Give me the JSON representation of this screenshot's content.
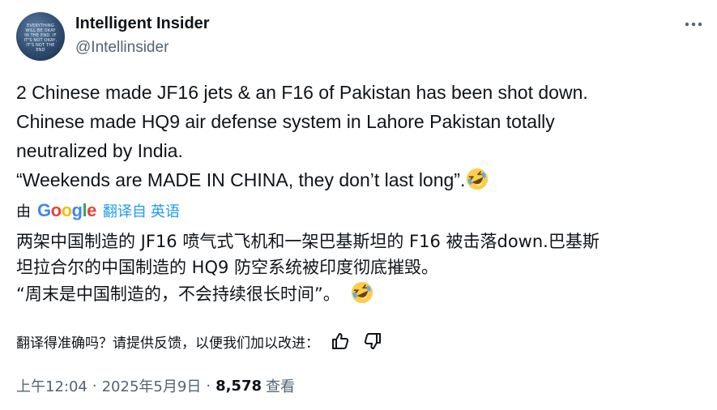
{
  "author": {
    "avatar_text": "EVERYTHING WILL BE OKAY IN THE END. IF IT'S NOT OKAY, IT'S NOT THE END",
    "display_name": "Intelligent Insider",
    "handle": "@Intellinsider",
    "avatar_color": "#2f4b6e"
  },
  "more_icon": "ellipsis-icon",
  "tweet": {
    "lines": [
      "2 Chinese made JF16 jets & an F16 of Pakistan has been shot down.",
      "Chinese made HQ9 air defense system in Lahore Pakistan totally",
      "neutralized by India.",
      "“Weekends are MADE IN CHINA, they don’t last long”."
    ],
    "emoji": "rolling-on-floor-laughing"
  },
  "translation_bar": {
    "by_label": "由",
    "google_letters": [
      "G",
      "o",
      "o",
      "g",
      "l",
      "e"
    ],
    "google_colors": [
      "#4285F4",
      "#EA4335",
      "#FBBC05",
      "#4285F4",
      "#34A853",
      "#EA4335"
    ],
    "translated_from": "翻译自 英语",
    "link_color": "#1d9bf0"
  },
  "translation": {
    "lines": [
      "两架中国制造的 JF16 喷气式飞机和一架巴基斯坦的 F16 被击落down.巴基斯",
      "坦拉合尔的中国制造的 HQ9 防空系统被印度彻底摧毁。",
      "“周末是中国制造的，不会持续很长时间”。 "
    ]
  },
  "feedback": {
    "prompt": "翻译得准确吗？请提供反馈，以便我们加以改进：",
    "thumbs_up_icon": "thumbs-up-icon",
    "thumbs_down_icon": "thumbs-down-icon"
  },
  "meta": {
    "time": "上午12:04",
    "separator": "·",
    "date": "2025年5月9日",
    "views_count": "8,578",
    "views_label": "查看"
  }
}
